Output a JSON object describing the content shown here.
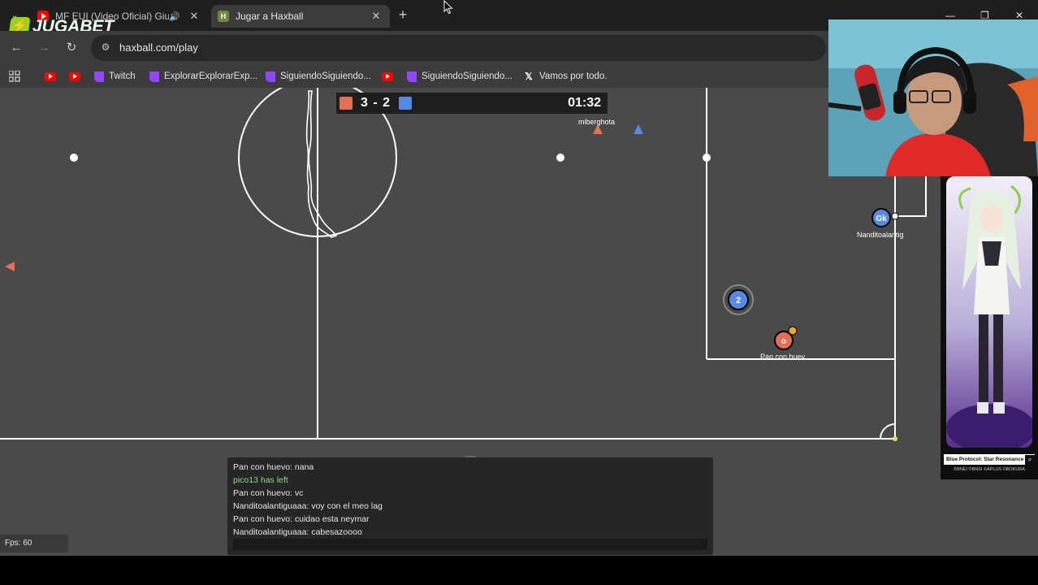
{
  "tabs": [
    {
      "title": "MF EUI (Video Oficial) Giulia",
      "icon": "youtube-icon",
      "audio": true
    },
    {
      "title": "Jugar a Haxball",
      "icon": "haxball-icon",
      "active": true
    }
  ],
  "overlay_brand": {
    "text": "JUGABET"
  },
  "address_bar": {
    "url": "haxball.com/play"
  },
  "bookmarks": [
    {
      "label": "",
      "icon": "youtube-icon"
    },
    {
      "label": "",
      "icon": "youtube-icon"
    },
    {
      "label": "Twitch",
      "icon": "twitch-icon"
    },
    {
      "label": "ExplorarExplorarExp...",
      "icon": "twitch-icon"
    },
    {
      "label": "SiguiendoSiguiendo...",
      "icon": "twitch-icon"
    },
    {
      "label": "",
      "icon": "youtube-icon"
    },
    {
      "label": "SiguiendoSiguiendo...",
      "icon": "twitch-icon"
    },
    {
      "label": "Vamos por todo.",
      "icon": "x-icon"
    }
  ],
  "scoreboard": {
    "red_score": 3,
    "blue_score": 2,
    "score_text": "3 - 2",
    "time": "01:32",
    "red_color": "#e56e56",
    "blue_color": "#5689e5"
  },
  "players": [
    {
      "name": "miberghota",
      "team": "red",
      "label": ""
    },
    {
      "name": "Nanditoalantig",
      "team": "blue",
      "label": "Gk"
    },
    {
      "name": "",
      "team": "blue",
      "label": "2"
    },
    {
      "name": "Pan con huev",
      "team": "red",
      "label": "o"
    }
  ],
  "chat": {
    "messages": [
      {
        "text": "Pan con huevo: nana",
        "system": false
      },
      {
        "text": "pico13 has left",
        "system": true
      },
      {
        "text": "Pan con huevo: vc",
        "system": false
      },
      {
        "text": "Nanditoalantiguaaa: voy con el meo lag",
        "system": false
      },
      {
        "text": "Pan con huevo: cuidao esta neymar",
        "system": false
      },
      {
        "text": "Nanditoalantiguaaa: cabesazoooo",
        "system": false
      }
    ]
  },
  "fps": {
    "label": "Fps: 60"
  },
  "ad": {
    "title": "Blue Protocol: Star Resonance",
    "credit": "©BNEI ©BNSI ©APLUS ©BOKURA"
  }
}
